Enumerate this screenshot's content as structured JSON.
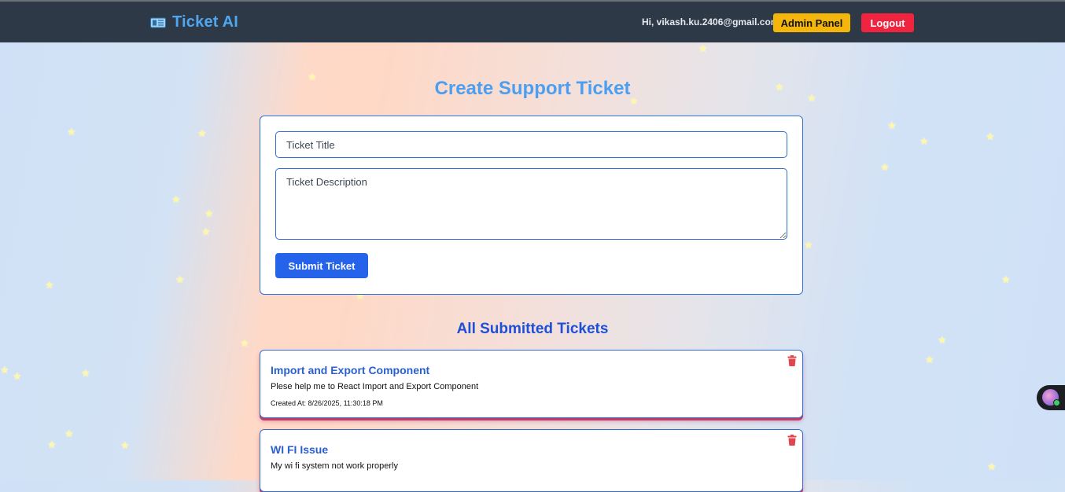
{
  "navbar": {
    "brand_icon": "ticket-icon",
    "brand": "Ticket AI",
    "greeting": "Hi, vikash.ku.2406@gmail.com",
    "admin_label": "Admin Panel",
    "logout_label": "Logout"
  },
  "form": {
    "heading": "Create Support Ticket",
    "title_placeholder": "Ticket Title",
    "description_placeholder": "Ticket Description",
    "submit_label": "Submit Ticket"
  },
  "tickets": {
    "heading": "All Submitted Tickets",
    "items": [
      {
        "title": "Import and Export Component",
        "description": "Plese help me to React Import and Export Component",
        "created": "Created At: 8/26/2025, 11:30:18 PM"
      },
      {
        "title": "WI FI Issue",
        "description": "My wi fi system not work properly"
      }
    ]
  },
  "colors": {
    "navbar_bg": "#2e3947",
    "brand": "#4ea7f0",
    "admin_button": "#f4b60a",
    "logout_button": "#f0243e",
    "submit_button": "#2563eb",
    "heading": "#4c9ff0",
    "ticket_title": "#2a5fd0",
    "delete_icon": "#e2454d"
  }
}
